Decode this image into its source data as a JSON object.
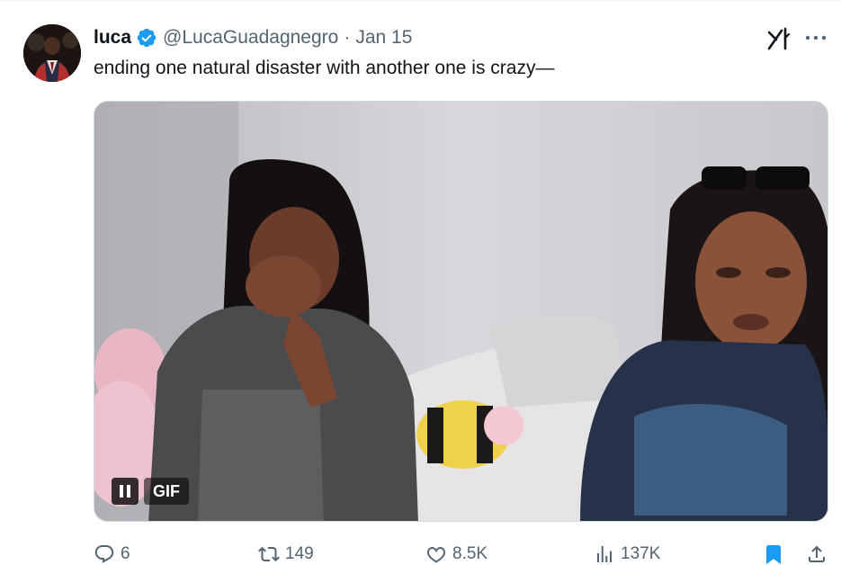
{
  "tweet": {
    "author": {
      "display_name": "luca",
      "handle": "@LucaGuadagnegro",
      "verified": true,
      "avatar": "avatar-photo"
    },
    "separator": "·",
    "date": "Jan 15",
    "text": "ending one natural disaster with another one is crazy—",
    "media": {
      "type": "gif",
      "badge_label": "GIF",
      "pause_icon": "pause-icon"
    },
    "top_right_icons": [
      "grok-icon",
      "more-icon"
    ],
    "actions": {
      "reply_count": "6",
      "retweet_count": "149",
      "like_count": "8.5K",
      "view_count": "137K",
      "bookmarked": true,
      "share_icon": "share-icon"
    }
  },
  "colors": {
    "verified_blue": "#1d9bf0",
    "secondary_text": "#536471",
    "primary_text": "#0f1419",
    "bookmark_active": "#1d9bf0"
  }
}
